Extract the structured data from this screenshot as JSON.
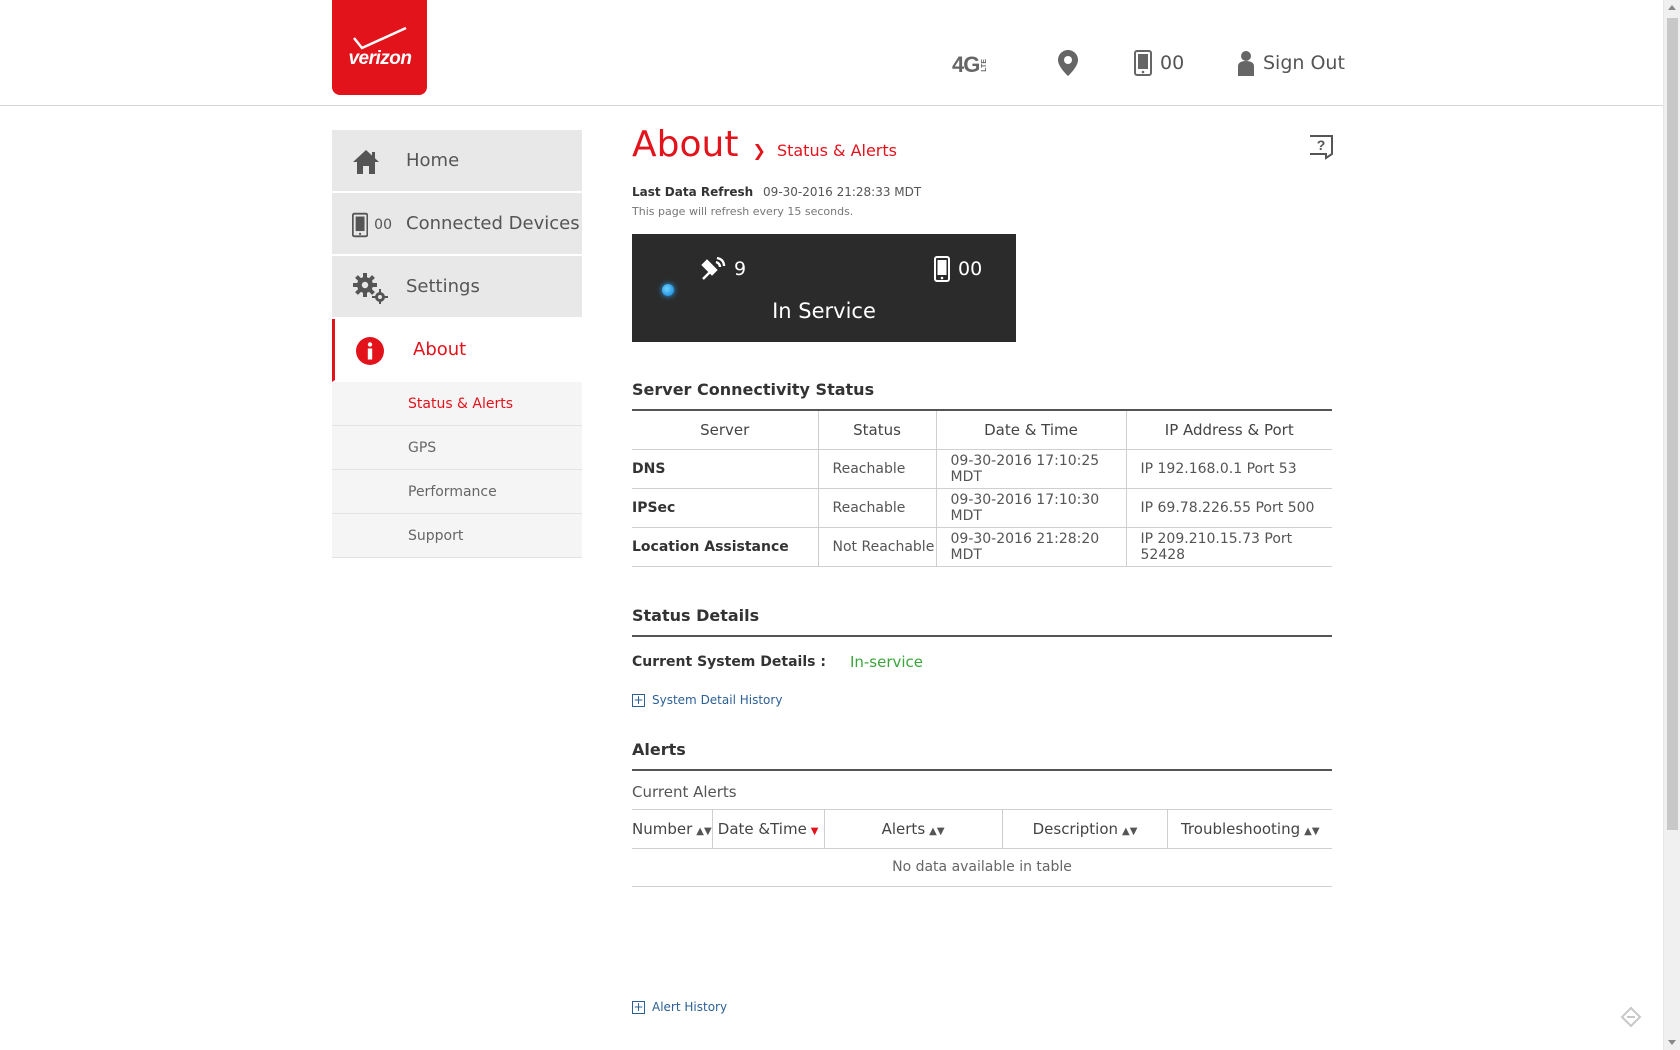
{
  "header": {
    "logo_text": "verizon",
    "network": "4G",
    "network_sub": "LTE",
    "devices_count": "00",
    "sign_out": "Sign Out"
  },
  "sidebar": {
    "items": [
      {
        "label": "Home",
        "icon": "home-icon"
      },
      {
        "label": "Connected Devices",
        "badge": "00",
        "icon": "device-icon"
      },
      {
        "label": "Settings",
        "icon": "gear-icon"
      },
      {
        "label": "About",
        "icon": "info-icon",
        "active": true
      }
    ],
    "sub_items": [
      {
        "label": "Status & Alerts",
        "active": true
      },
      {
        "label": "GPS"
      },
      {
        "label": "Performance"
      },
      {
        "label": "Support"
      }
    ]
  },
  "main": {
    "title": "About",
    "breadcrumb": "Status & Alerts",
    "last_refresh_label": "Last Data Refresh",
    "last_refresh_value": "09-30-2016 21:28:33 MDT",
    "refresh_note": "This page will refresh every 15 seconds."
  },
  "status_box": {
    "satellites": "9",
    "devices": "00",
    "service": "In Service"
  },
  "server": {
    "title": "Server Connectivity Status",
    "headers": [
      "Server",
      "Status",
      "Date & Time",
      "IP Address & Port"
    ],
    "rows": [
      {
        "server": "DNS",
        "status": "Reachable",
        "time": "09-30-2016 17:10:25 MDT",
        "ip": "IP 192.168.0.1 Port 53"
      },
      {
        "server": "IPSec",
        "status": "Reachable",
        "time": "09-30-2016 17:10:30 MDT",
        "ip": "IP 69.78.226.55 Port 500"
      },
      {
        "server": "Location Assistance",
        "status": "Not Reachable",
        "time": "09-30-2016 21:28:20 MDT",
        "ip": "IP 209.210.15.73 Port 52428"
      }
    ]
  },
  "details": {
    "title": "Status Details",
    "current_label": "Current System Details :",
    "current_value": "In-service",
    "history_link": "System Detail History"
  },
  "alerts": {
    "title": "Alerts",
    "current_label": "Current Alerts",
    "headers": [
      "Number",
      "Date &Time",
      "Alerts",
      "Description",
      "Troubleshooting"
    ],
    "empty": "No data available in table",
    "history_link": "Alert History"
  },
  "colors": {
    "brand": "#e3131c",
    "ok": "#3aa53a",
    "link": "#2c5f95"
  }
}
